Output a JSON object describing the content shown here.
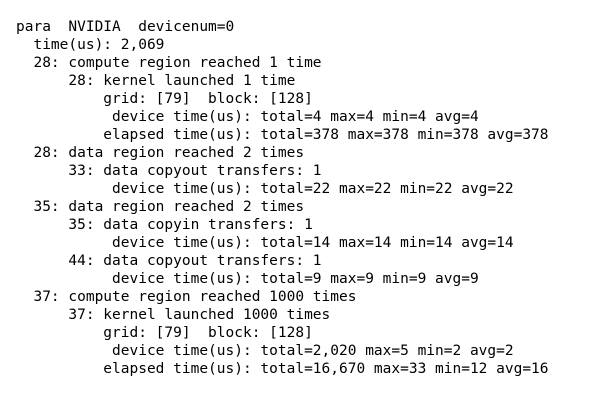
{
  "profile_output": {
    "lines": [
      "para  NVIDIA  devicenum=0",
      "  time(us): 2,069",
      "  28: compute region reached 1 time",
      "      28: kernel launched 1 time",
      "          grid: [79]  block: [128]",
      "           device time(us): total=4 max=4 min=4 avg=4",
      "          elapsed time(us): total=378 max=378 min=378 avg=378",
      "  28: data region reached 2 times",
      "      33: data copyout transfers: 1",
      "           device time(us): total=22 max=22 min=22 avg=22",
      "  35: data region reached 2 times",
      "      35: data copyin transfers: 1",
      "           device time(us): total=14 max=14 min=14 avg=14",
      "      44: data copyout transfers: 1",
      "           device time(us): total=9 max=9 min=9 avg=9",
      "  37: compute region reached 1000 times",
      "      37: kernel launched 1000 times",
      "          grid: [79]  block: [128]",
      "           device time(us): total=2,020 max=5 min=2 avg=2",
      "          elapsed time(us): total=16,670 max=33 min=12 avg=16"
    ]
  }
}
